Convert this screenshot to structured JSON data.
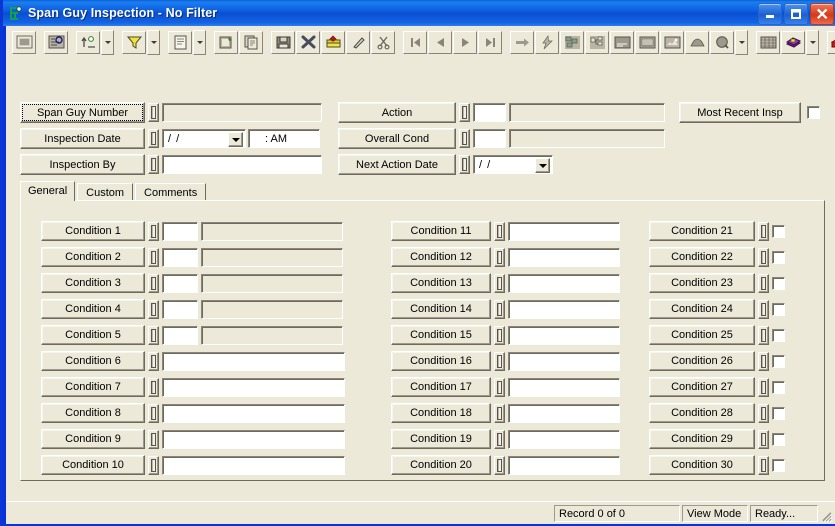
{
  "window": {
    "title": "Span Guy Inspection - No Filter",
    "icon": "app-person-icon",
    "caption_buttons": [
      {
        "name": "minimize-button",
        "glyph": "minimize-icon"
      },
      {
        "name": "maximize-button",
        "glyph": "maximize-icon"
      },
      {
        "name": "close-button",
        "glyph": "close-icon"
      }
    ]
  },
  "toolbar": {
    "buttons": [
      {
        "name": "select-all-icon",
        "title": "Select All"
      },
      {
        "name": "find-record-icon",
        "title": "Find"
      },
      {
        "name": "sort-icon",
        "title": "Sort",
        "dropdown": true
      },
      {
        "name": "filter-funnel-icon",
        "title": "Filter",
        "dropdown": true
      },
      {
        "name": "new-record-icon",
        "title": "New",
        "dropdown": true
      },
      {
        "name": "edit-record-icon",
        "title": "Edit"
      },
      {
        "name": "copy-record-icon",
        "title": "Copy"
      },
      {
        "name": "save-icon",
        "title": "Save"
      },
      {
        "name": "delete-icon",
        "title": "Delete"
      },
      {
        "name": "post-icon",
        "title": "Post"
      },
      {
        "name": "pencil-icon",
        "title": "Edit Mode"
      },
      {
        "name": "cut-scissors-icon",
        "title": "Cut"
      },
      {
        "name": "first-record-icon",
        "title": "First"
      },
      {
        "name": "previous-record-icon",
        "title": "Previous"
      },
      {
        "name": "next-record-icon",
        "title": "Next"
      },
      {
        "name": "last-record-icon",
        "title": "Last"
      },
      {
        "name": "goto-icon",
        "title": "Go To"
      },
      {
        "name": "lightning-icon",
        "title": "Run"
      },
      {
        "name": "hierarchy-icon",
        "title": "Hierarchy"
      },
      {
        "name": "structure-icon",
        "title": "Structure"
      },
      {
        "name": "notes-icon",
        "title": "Notes"
      },
      {
        "name": "report-icon",
        "title": "Report"
      },
      {
        "name": "attachment-icon",
        "title": "Attachments"
      },
      {
        "name": "map-icon",
        "title": "Map"
      },
      {
        "name": "search-globe-icon",
        "title": "Search",
        "dropdown": true
      },
      {
        "name": "grid-icon",
        "title": "Grid"
      },
      {
        "name": "books-icon",
        "title": "Library",
        "dropdown": true
      },
      {
        "name": "exit-icon",
        "title": "Exit"
      }
    ]
  },
  "header": {
    "left_fields": [
      {
        "name": "span-guy-number",
        "label": "Span Guy Number",
        "type": "text",
        "value": "",
        "disabled": true,
        "focused": true
      },
      {
        "name": "inspection-date",
        "label": "Inspection Date",
        "type": "date-time",
        "value": "/  /",
        "time_value": ":     AM"
      },
      {
        "name": "inspection-by",
        "label": "Inspection By",
        "type": "text",
        "value": "",
        "disabled": false
      }
    ],
    "middle_fields": [
      {
        "name": "action",
        "label": "Action",
        "code_value": "",
        "desc_value": "",
        "desc_disabled": true
      },
      {
        "name": "overall-cond",
        "label": "Overall Cond",
        "code_value": "",
        "desc_value": "",
        "desc_disabled": true
      },
      {
        "name": "next-action-date",
        "label": "Next Action Date",
        "type": "date",
        "value": "/  /"
      }
    ],
    "most_recent": {
      "name": "most-recent-insp",
      "label": "Most Recent Insp",
      "checkbox_checked": false
    }
  },
  "tabs": [
    {
      "name": "tab-general",
      "label": "General",
      "active": true
    },
    {
      "name": "tab-custom",
      "label": "Custom",
      "active": false
    },
    {
      "name": "tab-comments",
      "label": "Comments",
      "active": false
    }
  ],
  "conditions": {
    "column1": [
      {
        "label": "Condition 1",
        "code": "",
        "desc": "",
        "style": "code-desc"
      },
      {
        "label": "Condition 2",
        "code": "",
        "desc": "",
        "style": "code-desc"
      },
      {
        "label": "Condition 3",
        "code": "",
        "desc": "",
        "style": "code-desc"
      },
      {
        "label": "Condition 4",
        "code": "",
        "desc": "",
        "style": "code-desc"
      },
      {
        "label": "Condition 5",
        "code": "",
        "desc": "",
        "style": "code-desc"
      },
      {
        "label": "Condition 6",
        "value": "",
        "style": "wide"
      },
      {
        "label": "Condition 7",
        "value": "",
        "style": "wide"
      },
      {
        "label": "Condition 8",
        "value": "",
        "style": "wide"
      },
      {
        "label": "Condition 9",
        "value": "",
        "style": "wide"
      },
      {
        "label": "Condition 10",
        "value": "",
        "style": "wide"
      }
    ],
    "column2": [
      {
        "label": "Condition 11",
        "value": "",
        "style": "wide"
      },
      {
        "label": "Condition 12",
        "value": "",
        "style": "wide"
      },
      {
        "label": "Condition 13",
        "value": "",
        "style": "wide"
      },
      {
        "label": "Condition 14",
        "value": "",
        "style": "wide"
      },
      {
        "label": "Condition 15",
        "value": "",
        "style": "wide"
      },
      {
        "label": "Condition 16",
        "value": "",
        "style": "wide"
      },
      {
        "label": "Condition 17",
        "value": "",
        "style": "wide"
      },
      {
        "label": "Condition 18",
        "value": "",
        "style": "wide"
      },
      {
        "label": "Condition 19",
        "value": "",
        "style": "wide"
      },
      {
        "label": "Condition 20",
        "value": "",
        "style": "wide"
      }
    ],
    "column3": [
      {
        "label": "Condition 21",
        "checked": false,
        "style": "checkbox"
      },
      {
        "label": "Condition 22",
        "checked": false,
        "style": "checkbox"
      },
      {
        "label": "Condition 23",
        "checked": false,
        "style": "checkbox"
      },
      {
        "label": "Condition 24",
        "checked": false,
        "style": "checkbox"
      },
      {
        "label": "Condition 25",
        "checked": false,
        "style": "checkbox"
      },
      {
        "label": "Condition 26",
        "checked": false,
        "style": "checkbox"
      },
      {
        "label": "Condition 27",
        "checked": false,
        "style": "checkbox"
      },
      {
        "label": "Condition 28",
        "checked": false,
        "style": "checkbox"
      },
      {
        "label": "Condition 29",
        "checked": false,
        "style": "checkbox"
      },
      {
        "label": "Condition 30",
        "checked": false,
        "style": "checkbox"
      }
    ]
  },
  "statusbar": {
    "record": "Record 0 of 0",
    "mode": "View Mode",
    "state": "Ready..."
  },
  "colors": {
    "face": "#ece9d8",
    "title_blue": "#0a4fd4",
    "close_red": "#d4391a",
    "field_white": "#ffffff",
    "shadow": "#6f6a5e"
  }
}
